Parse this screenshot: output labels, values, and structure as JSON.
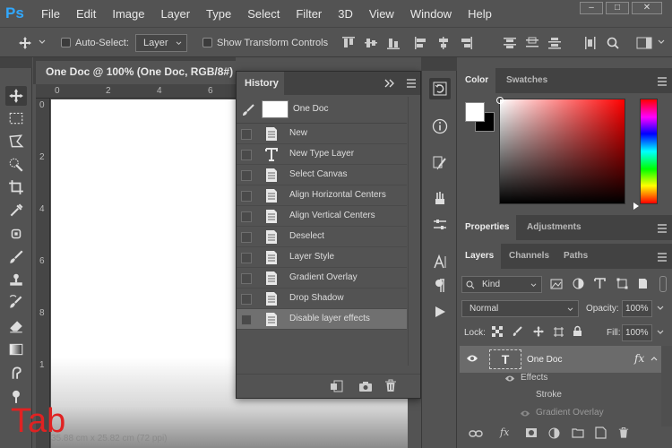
{
  "app": {
    "logo": "Ps"
  },
  "menu": [
    "File",
    "Edit",
    "Image",
    "Layer",
    "Type",
    "Select",
    "Filter",
    "3D",
    "View",
    "Window",
    "Help"
  ],
  "window_controls": {
    "minimize": "–",
    "maximize": "□",
    "close": "✕"
  },
  "options_bar": {
    "auto_select_label": "Auto-Select:",
    "auto_select_target": "Layer",
    "show_transform_label": "Show Transform Controls"
  },
  "document": {
    "tab_title": "One Doc @ 100% (One Doc, RGB/8#) *",
    "ruler_top": [
      "0",
      "2",
      "4",
      "6"
    ],
    "ruler_left": [
      "0",
      "2",
      "4",
      "6",
      "8",
      "1"
    ],
    "status_text": "35.88 cm x 25.82 cm (72 ppi)"
  },
  "overlay_caption": "Tab",
  "history": {
    "title": "History",
    "snapshot_label": "One Doc",
    "items": [
      {
        "label": "New",
        "icon": "document-icon"
      },
      {
        "label": "New Type Layer",
        "icon": "type-icon"
      },
      {
        "label": "Select Canvas",
        "icon": "document-icon"
      },
      {
        "label": "Align Horizontal Centers",
        "icon": "document-icon"
      },
      {
        "label": "Align Vertical Centers",
        "icon": "document-icon"
      },
      {
        "label": "Deselect",
        "icon": "document-icon"
      },
      {
        "label": "Layer Style",
        "icon": "document-icon"
      },
      {
        "label": "Gradient Overlay",
        "icon": "document-icon"
      },
      {
        "label": "Drop Shadow",
        "icon": "document-icon"
      },
      {
        "label": "Disable layer effects",
        "icon": "document-icon"
      }
    ],
    "selected_index": 9
  },
  "color_panel": {
    "tabs": [
      "Color",
      "Swatches"
    ],
    "foreground": "#ffffff",
    "background": "#000000",
    "hue": "#ff0000"
  },
  "properties_panel": {
    "tabs": [
      "Properties",
      "Adjustments"
    ]
  },
  "layers_panel": {
    "tabs": [
      "Layers",
      "Channels",
      "Paths"
    ],
    "filter_kind": "Kind",
    "blend_mode": "Normal",
    "opacity_label": "Opacity:",
    "opacity_value": "100%",
    "lock_label": "Lock:",
    "fill_label": "Fill:",
    "fill_value": "100%",
    "layer_name": "One Doc",
    "layer_thumb_glyph": "T",
    "fx_label": "fx",
    "effects_label": "Effects",
    "effects": [
      "Stroke",
      "Gradient Overlay"
    ]
  },
  "colors": {
    "accent_ps": "#31a8ff",
    "overlay_red": "#e02222",
    "panel_bg": "#535353",
    "panel_dark": "#424242"
  }
}
